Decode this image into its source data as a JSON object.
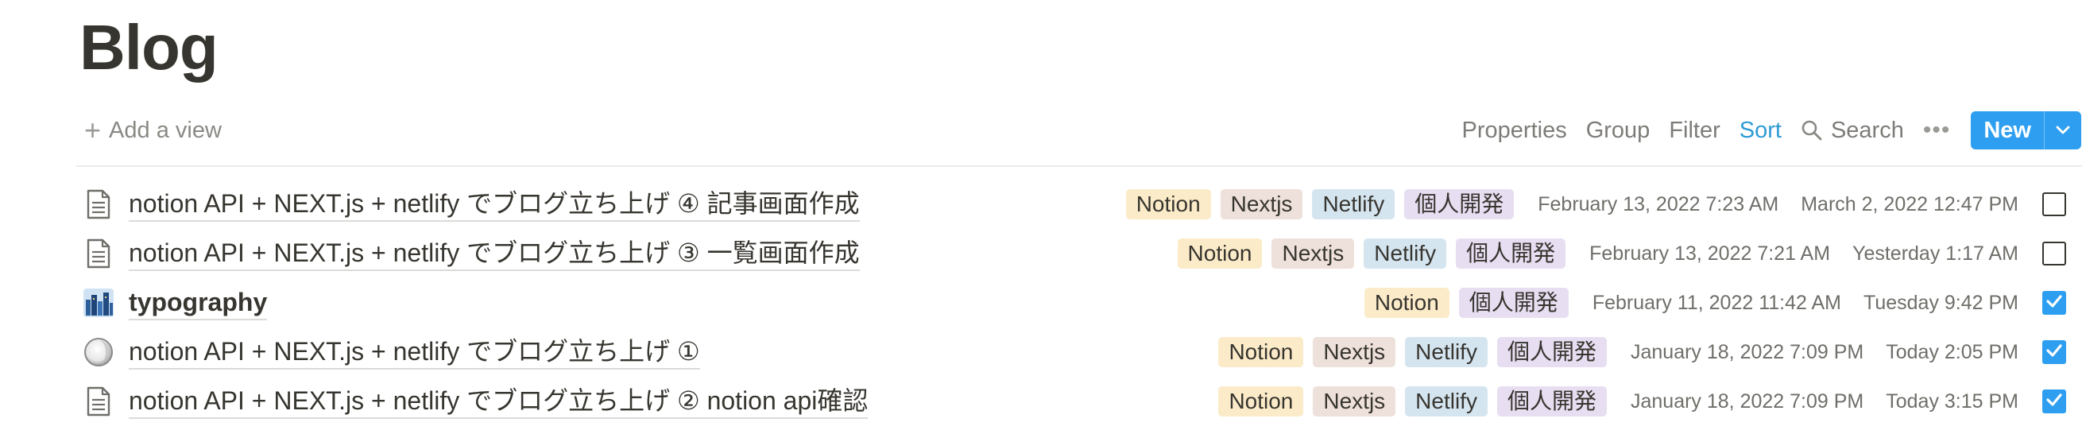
{
  "page": {
    "title": "Blog"
  },
  "view_bar": {
    "add_view_label": "Add a view"
  },
  "toolbar": {
    "properties": "Properties",
    "group": "Group",
    "filter": "Filter",
    "sort": "Sort",
    "search": "Search",
    "more": "•••",
    "new": "New"
  },
  "colors": {
    "accent": "#2e9ff0",
    "sort_active": "#2e9bd6",
    "tag_notion": "#fbebc9",
    "tag_nextjs": "#eee0da",
    "tag_netlify": "#d5e5f0",
    "tag_kojin": "#e8def2"
  },
  "rows": [
    {
      "icon": "document-icon",
      "title": "notion API + NEXT.js + netlify でブログ立ち上げ ④ 記事画面作成",
      "tags": [
        "Notion",
        "Nextjs",
        "Netlify",
        "個人開発"
      ],
      "created": "February 13, 2022 7:23 AM",
      "edited": "March 2, 2022 12:47 PM",
      "checked": false
    },
    {
      "icon": "document-icon",
      "title": "notion API + NEXT.js + netlify でブログ立ち上げ ③ 一覧画面作成",
      "tags": [
        "Notion",
        "Nextjs",
        "Netlify",
        "個人開発"
      ],
      "created": "February 13, 2022 7:21 AM",
      "edited": "Yesterday 1:17 AM",
      "checked": false
    },
    {
      "icon": "city-image-icon",
      "title": "typography",
      "tags": [
        "Notion",
        "個人開発"
      ],
      "created": "February 11, 2022 11:42 AM",
      "edited": "Tuesday 9:42 PM",
      "checked": true
    },
    {
      "icon": "moon-circle-icon",
      "title": "notion API + NEXT.js + netlify でブログ立ち上げ ①",
      "tags": [
        "Notion",
        "Nextjs",
        "Netlify",
        "個人開発"
      ],
      "created": "January 18, 2022 7:09 PM",
      "edited": "Today 2:05 PM",
      "checked": true
    },
    {
      "icon": "document-icon",
      "title": "notion API + NEXT.js + netlify でブログ立ち上げ ② notion api確認",
      "tags": [
        "Notion",
        "Nextjs",
        "Netlify",
        "個人開発"
      ],
      "created": "January 18, 2022 7:09 PM",
      "edited": "Today 3:15 PM",
      "checked": true
    }
  ]
}
